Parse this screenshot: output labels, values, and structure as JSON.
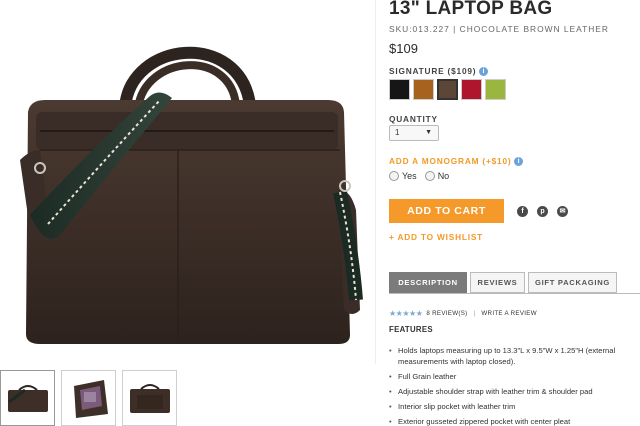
{
  "product": {
    "title": "13\" LAPTOP BAG",
    "sku": "SKU:013.227 | CHOCOLATE BROWN LEATHER",
    "price": "$109"
  },
  "colors": {
    "label": "SIGNATURE ($109)",
    "info_icon": "info-icon",
    "swatches": [
      {
        "name": "black",
        "hex": "#161616"
      },
      {
        "name": "tan",
        "hex": "#a8621f"
      },
      {
        "name": "chocolate-brown",
        "hex": "#5b4637",
        "selected": true
      },
      {
        "name": "red",
        "hex": "#b0152e"
      },
      {
        "name": "green",
        "hex": "#9bb63e"
      }
    ]
  },
  "quantity": {
    "label": "QUANTITY",
    "value": "1"
  },
  "monogram": {
    "label": "ADD A MONOGRAM (+$10)",
    "options": [
      "Yes",
      "No"
    ]
  },
  "actions": {
    "add_to_cart": "ADD TO CART",
    "wishlist": "+ ADD TO WISHLIST",
    "share_icons": [
      "facebook-icon",
      "pinterest-icon",
      "email-icon"
    ]
  },
  "tabs": [
    {
      "label": "DESCRIPTION",
      "active": true
    },
    {
      "label": "REVIEWS",
      "active": false
    },
    {
      "label": "GIFT PACKAGING",
      "active": false
    }
  ],
  "reviews": {
    "stars": "★★★★★",
    "count": "8 REVIEW(S)",
    "separator": "|",
    "write": "WRITE A REVIEW"
  },
  "features": {
    "title": "FEATURES",
    "items": [
      "Holds laptops measuring up to 13.3\"L x 9.5\"W x 1.25\"H (external measurements with laptop closed).",
      "Full Grain leather",
      "Adjustable shoulder strap with leather trim & shoulder pad",
      "Interior slip pocket with leather trim",
      "Exterior gusseted zippered pocket with center pleat"
    ]
  },
  "theme": {
    "accent": "#f59a2a",
    "tab_active": "#7b7b7b",
    "star": "#7da8cf"
  }
}
